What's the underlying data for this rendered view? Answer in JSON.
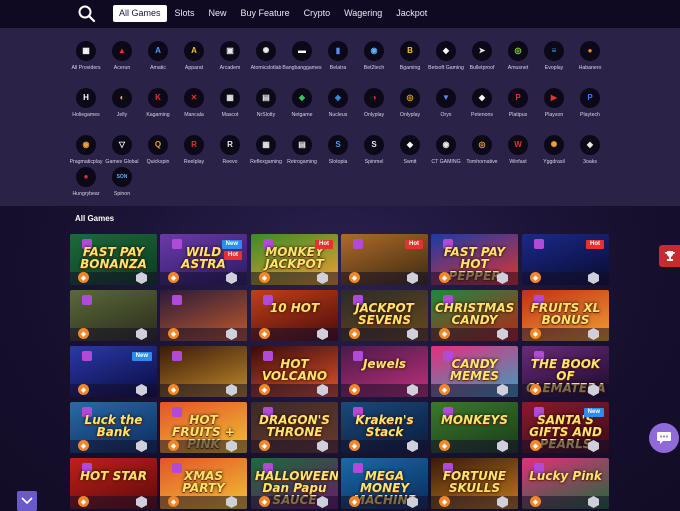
{
  "nav": {
    "tabs": [
      {
        "label": "All Games",
        "active": true
      },
      {
        "label": "Slots"
      },
      {
        "label": "New"
      },
      {
        "label": "Buy Feature"
      },
      {
        "label": "Crypto"
      },
      {
        "label": "Wagering"
      },
      {
        "label": "Jackpot"
      }
    ]
  },
  "providers": [
    {
      "label": "All Providers",
      "glyph": "▦",
      "color": "#ffffff"
    },
    {
      "label": "Acerun",
      "glyph": "▲",
      "color": "#e2342c"
    },
    {
      "label": "Amatic",
      "glyph": "A",
      "color": "#4aa0ff"
    },
    {
      "label": "Apparat",
      "glyph": "A",
      "color": "#f2c230"
    },
    {
      "label": "Arcadem",
      "glyph": "▣",
      "color": "#e8e8e8"
    },
    {
      "label": "Atomicslotlab",
      "glyph": "✺",
      "color": "#e8e8e8"
    },
    {
      "label": "Bangbanggames",
      "glyph": "▬",
      "color": "#ffffff"
    },
    {
      "label": "Belatra",
      "glyph": "▮",
      "color": "#5a8cf0"
    },
    {
      "label": "Bet2tech",
      "glyph": "◉",
      "color": "#5ab0ff"
    },
    {
      "label": "Bgaming",
      "glyph": "B",
      "color": "#f2c230"
    },
    {
      "label": "Betsoft Gaming",
      "glyph": "◆",
      "color": "#ffffff"
    },
    {
      "label": "Bulletproof",
      "glyph": "➤",
      "color": "#e8e8e8"
    },
    {
      "label": "Amusnet",
      "glyph": "◎",
      "color": "#8be04a"
    },
    {
      "label": "Evoplay",
      "glyph": "≡",
      "color": "#3aa0ff"
    },
    {
      "label": "Habanero",
      "glyph": "●",
      "color": "#f08a2a"
    },
    {
      "label": "Holiegames",
      "glyph": "H",
      "color": "#ffffff"
    },
    {
      "label": "Jelly",
      "glyph": "◐",
      "color": "#f2c230"
    },
    {
      "label": "Kagaming",
      "glyph": "K",
      "color": "#e2342c"
    },
    {
      "label": "Mancala",
      "glyph": "✕",
      "color": "#e2342c"
    },
    {
      "label": "Mascot",
      "glyph": "▦",
      "color": "#e8e8e8"
    },
    {
      "label": "NrSlotty",
      "glyph": "▤",
      "color": "#e8e8e8"
    },
    {
      "label": "Netgame",
      "glyph": "◆",
      "color": "#3ac060"
    },
    {
      "label": "Nucleus",
      "glyph": "◈",
      "color": "#3a90e0"
    },
    {
      "label": "Onlyplay",
      "glyph": "◑",
      "color": "#e2342c"
    },
    {
      "label": "Onlyplay",
      "glyph": "◎",
      "color": "#f2a030"
    },
    {
      "label": "Oryx",
      "glyph": "▼",
      "color": "#5a8cf0"
    },
    {
      "label": "Petenons",
      "glyph": "◆",
      "color": "#ffffff"
    },
    {
      "label": "Platipus",
      "glyph": "P",
      "color": "#e2342c"
    },
    {
      "label": "Playson",
      "glyph": "▶",
      "color": "#e2342c"
    },
    {
      "label": "Playtech",
      "glyph": "P",
      "color": "#3a7cf0"
    },
    {
      "label": "Pragmaticplay",
      "glyph": "◉",
      "color": "#f2a030"
    },
    {
      "label": "Games Global",
      "glyph": "▽",
      "color": "#ffffff"
    },
    {
      "label": "Quickspin",
      "glyph": "Q",
      "color": "#f2a030"
    },
    {
      "label": "Reelplay",
      "glyph": "R",
      "color": "#e2342c"
    },
    {
      "label": "Reevo",
      "glyph": "R",
      "color": "#e8e8e8"
    },
    {
      "label": "Reflexgaming",
      "glyph": "▦",
      "color": "#e8e8e8"
    },
    {
      "label": "Retrogaming",
      "glyph": "▤",
      "color": "#e8e8e8"
    },
    {
      "label": "Slotopia",
      "glyph": "S",
      "color": "#3aa0ff"
    },
    {
      "label": "Spinmel",
      "glyph": "S",
      "color": "#e8e8e8"
    },
    {
      "label": "Swntt",
      "glyph": "◆",
      "color": "#ffffff"
    },
    {
      "label": "CT GAMING",
      "glyph": "◉",
      "color": "#e8e8e8"
    },
    {
      "label": "Tomhornative",
      "glyph": "◎",
      "color": "#f2a030"
    },
    {
      "label": "Winfast",
      "glyph": "W",
      "color": "#e2342c"
    },
    {
      "label": "Yggdrasil",
      "glyph": "✺",
      "color": "#f2a030"
    },
    {
      "label": "3oaks",
      "glyph": "◆",
      "color": "#e8e8e8"
    },
    {
      "label": "Hungrybear",
      "glyph": "●",
      "color": "#e2342c"
    },
    {
      "label": "Spinon",
      "glyph": "SON",
      "color": "#5ab0ff"
    }
  ],
  "games_title": "All Games",
  "games": [
    {
      "name": "FAST PAY BONANZA",
      "badge": "",
      "bg": "#1c6a3a",
      "bg2": "#0c3a20"
    },
    {
      "name": "WILD ASTRA",
      "badge": "New|Hot",
      "bg": "#6a3aa8",
      "bg2": "#2a1a60"
    },
    {
      "name": "MONKEY JACKPOT",
      "badge": "Hot",
      "bg": "#3a8a2a",
      "bg2": "#f2a030"
    },
    {
      "name": "",
      "badge": "Hot",
      "bg": "#b06a2a",
      "bg2": "#3a2a10"
    },
    {
      "name": "FAST PAY HOT PEPPER",
      "badge": "",
      "bg": "#1a3aa8",
      "bg2": "#e2342c"
    },
    {
      "name": "",
      "badge": "Hot",
      "bg": "#1a2a8a",
      "bg2": "#0a0a30"
    },
    {
      "name": "",
      "badge": "",
      "bg": "#5a6a3a",
      "bg2": "#2a2a1a"
    },
    {
      "name": "",
      "badge": "",
      "bg": "#2a1a3a",
      "bg2": "#c05a2a"
    },
    {
      "name": "10 HOT",
      "badge": "",
      "bg": "#c0401a",
      "bg2": "#4a0a0a"
    },
    {
      "name": "JACKPOT SEVENS",
      "badge": "",
      "bg": "#2a2a2a",
      "bg2": "#6a4a1a"
    },
    {
      "name": "CHRISTMAS CANDY",
      "badge": "",
      "bg": "#1a8a3a",
      "bg2": "#c0201a"
    },
    {
      "name": "FRUITS XL BONUS",
      "badge": "",
      "bg": "#c0301a",
      "bg2": "#f2a030"
    },
    {
      "name": "",
      "badge": "New",
      "bg": "#2a3aa8",
      "bg2": "#0a0a40"
    },
    {
      "name": "",
      "badge": "",
      "bg": "#3a1a0a",
      "bg2": "#c08a2a"
    },
    {
      "name": "HOT VOLCANO",
      "badge": "",
      "bg": "#3a0a0a",
      "bg2": "#e2542c"
    },
    {
      "name": "Jewels",
      "badge": "",
      "bg": "#4a1a4a",
      "bg2": "#c0307a"
    },
    {
      "name": "CANDY MEMES",
      "badge": "",
      "bg": "#e2307a",
      "bg2": "#3aa0c0"
    },
    {
      "name": "THE BOOK OF CLEMATERA",
      "badge": "",
      "bg": "#6a2a7a",
      "bg2": "#1a0a2a"
    },
    {
      "name": "Luck the Bank",
      "badge": "",
      "bg": "#2a6aa8",
      "bg2": "#0a2a5a"
    },
    {
      "name": "HOT FRUITS + PINK",
      "badge": "",
      "bg": "#e2542c",
      "bg2": "#f2c230"
    },
    {
      "name": "DRAGON'S THRONE",
      "badge": "",
      "bg": "#3a2a2a",
      "bg2": "#6a3a2a"
    },
    {
      "name": "Kraken's Stack",
      "badge": "",
      "bg": "#1a4a7a",
      "bg2": "#0a1a3a"
    },
    {
      "name": "MONKEYS",
      "badge": "",
      "bg": "#3a7a2a",
      "bg2": "#1a3a1a"
    },
    {
      "name": "SANTA'S GIFTS AND PEARLS",
      "badge": "New",
      "bg": "#8a1a2a",
      "bg2": "#3a0a1a"
    },
    {
      "name": "HOT STAR",
      "badge": "",
      "bg": "#c0201a",
      "bg2": "#5a0a0a"
    },
    {
      "name": "XMAS PARTY",
      "badge": "",
      "bg": "#e2542c",
      "bg2": "#f2c230"
    },
    {
      "name": "HALLOWEEN Dan Papu SAUCE",
      "badge": "",
      "bg": "#1a6a3a",
      "bg2": "#6a1a6a"
    },
    {
      "name": "MEGA MONEY MACHINE",
      "badge": "",
      "bg": "#1a6aa8",
      "bg2": "#0a2a5a"
    },
    {
      "name": "FORTUNE SKULLS",
      "badge": "",
      "bg": "#3a1a0a",
      "bg2": "#c07a1a"
    },
    {
      "name": "Lucky Pink",
      "badge": "",
      "bg": "#e2307a",
      "bg2": "#1a6a3a"
    }
  ],
  "colors": {
    "gem": "#f2872a",
    "new_badge": "#2d8cf0",
    "hot_badge": "#e5312f"
  }
}
